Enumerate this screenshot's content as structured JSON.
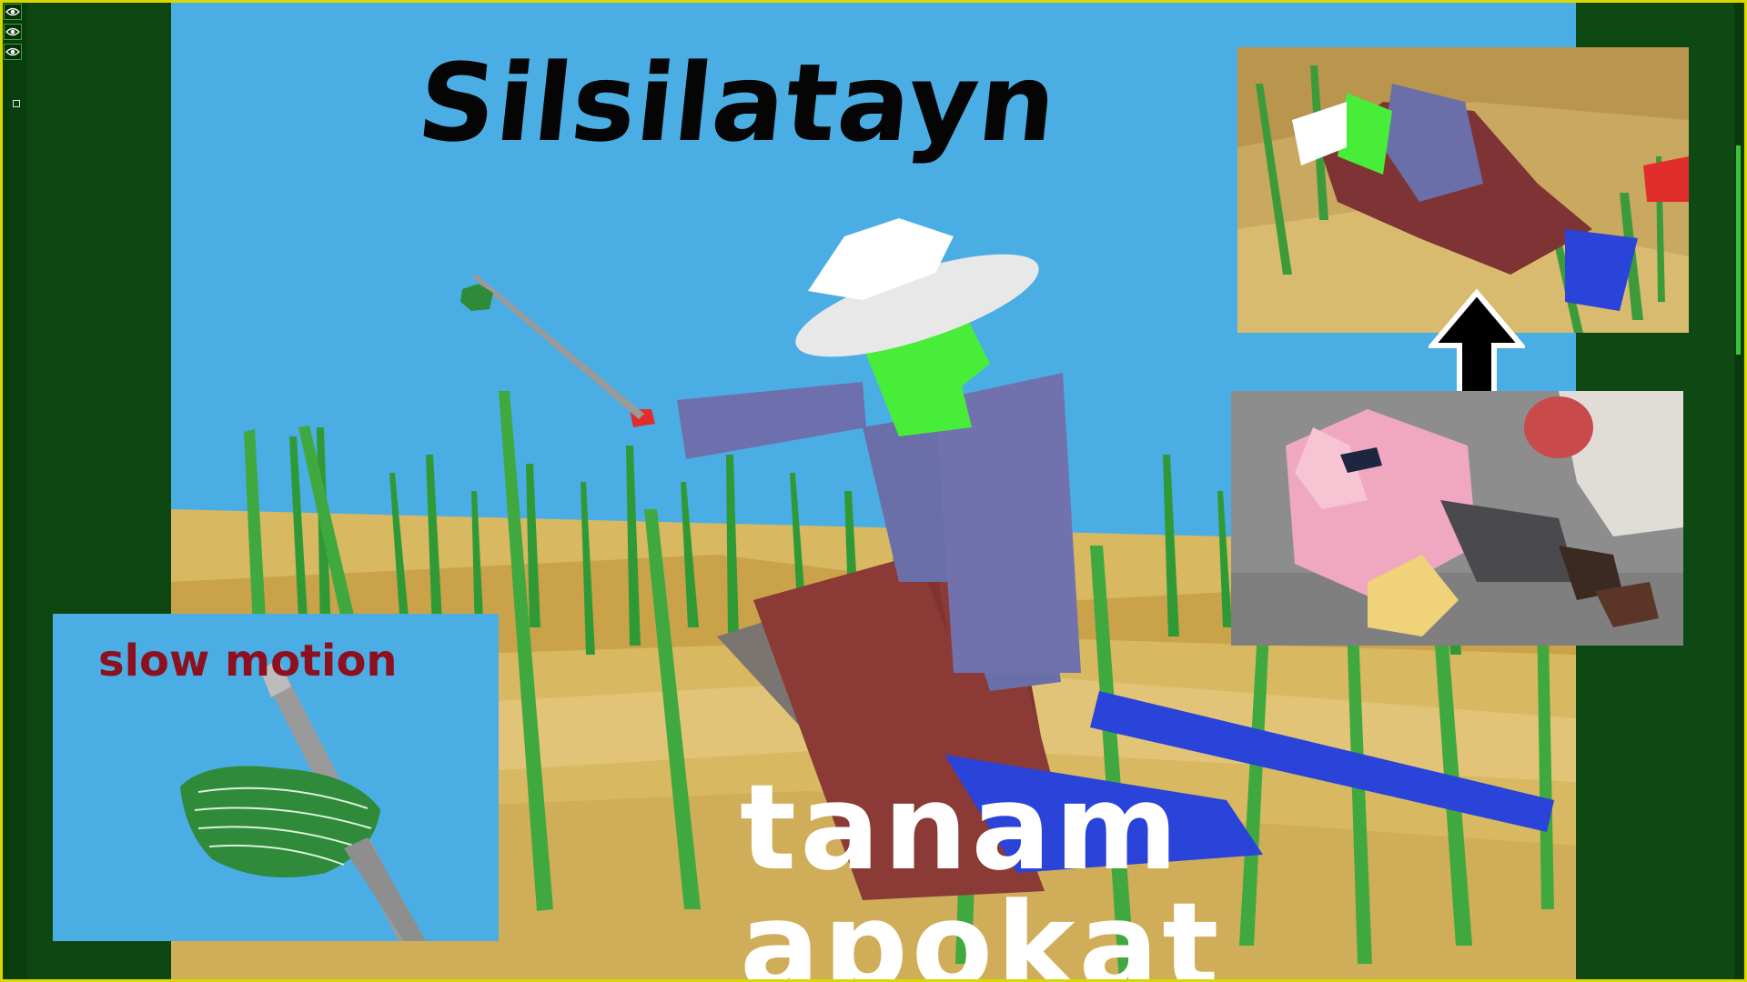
{
  "thumbnail": {
    "title": "Silsilatayn",
    "caption": "tanam apokat",
    "slow_motion_label": "slow motion"
  },
  "editor": {
    "layer_toggles": [
      "eye-icon",
      "eye-icon",
      "eye-icon"
    ]
  },
  "colors": {
    "sky": "#4aaee4",
    "ground": "#d8b860",
    "grass": "#2f9a35",
    "caption_text": "#ffffff",
    "title_text": "#050505",
    "slow_label": "#8c1020",
    "frame_accent": "#d8d800"
  }
}
